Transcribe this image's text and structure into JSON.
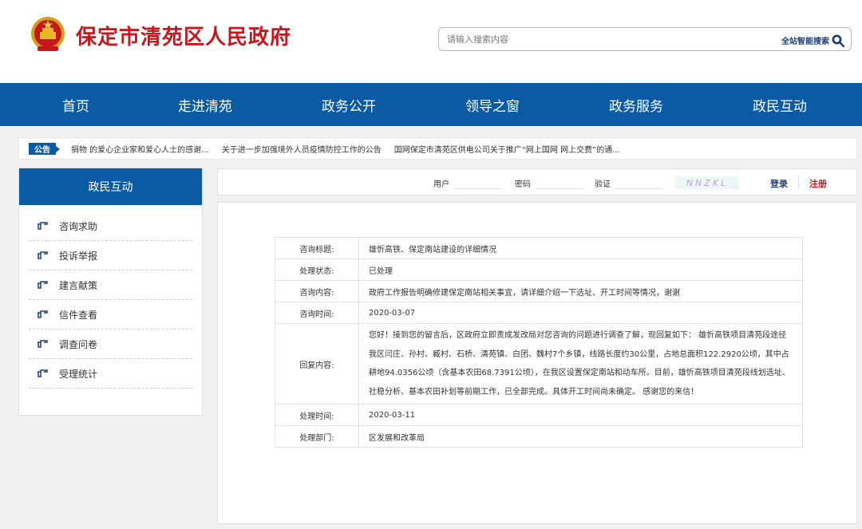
{
  "header": {
    "site_title": "保定市清苑区人民政府",
    "search_placeholder": "请输入搜索内容",
    "search_button": "全站智能搜索"
  },
  "nav": {
    "items": [
      "首页",
      "走进清苑",
      "政务公开",
      "领导之窗",
      "政务服务",
      "政民互动"
    ]
  },
  "notice": {
    "badge": "公告",
    "items": [
      "捐物 的爱心企业家和爱心人士的感谢...",
      "关于进一步加强境外人员疫情防控工作的公告",
      "国网保定市清苑区供电公司关于推广“网上国网 网上交费”的通..."
    ]
  },
  "sidebar": {
    "title": "政民互动",
    "items": [
      "咨询求助",
      "投诉举报",
      "建言献策",
      "信件查看",
      "调查问卷",
      "受理统计"
    ]
  },
  "login": {
    "user_label": "用户",
    "password_label": "密码",
    "verify_label": "验证",
    "captcha_text": "NNZKL",
    "login_label": "登录",
    "register_label": "注册"
  },
  "detail": {
    "rows": [
      {
        "key": "咨询标题:",
        "value": "雄忻高铁、保定南站建设的详细情况"
      },
      {
        "key": "处理状态:",
        "value": "已处理"
      },
      {
        "key": "咨询内容:",
        "value": "政府工作报告明确修建保定南站相关事宜，请详细介绍一下选址、开工时间等情况，谢谢"
      },
      {
        "key": "咨询时间:",
        "value": "2020-03-07"
      },
      {
        "key": "回复内容:",
        "value": "您好！接到您的留言后，区政府立即责成发改局对您咨询的问题进行调查了解，现回复如下： 雄忻高铁项目清苑段途径我区闫庄、孙村、臧村、石桥、清苑镇、白团、魏村7个乡镇，线路长度约30公里，占地总面积122.2920公顷，其中占耕地94.0356公顷（含基本农田68.7391公顷），在我区设置保定南站和动车所。目前，雄忻高铁项目清苑段线划选址、社稳分析、基本农田补划等前期工作，已全部完成。具体开工时间尚未确定。 感谢您的来信！"
      },
      {
        "key": "处理时间:",
        "value": "2020-03-11"
      },
      {
        "key": "处理部门:",
        "value": "区发展和改革局"
      }
    ]
  },
  "colors": {
    "brand_blue": "#0a5aa4",
    "title_red": "#c8161d",
    "link_navy": "#1e3f7a"
  }
}
